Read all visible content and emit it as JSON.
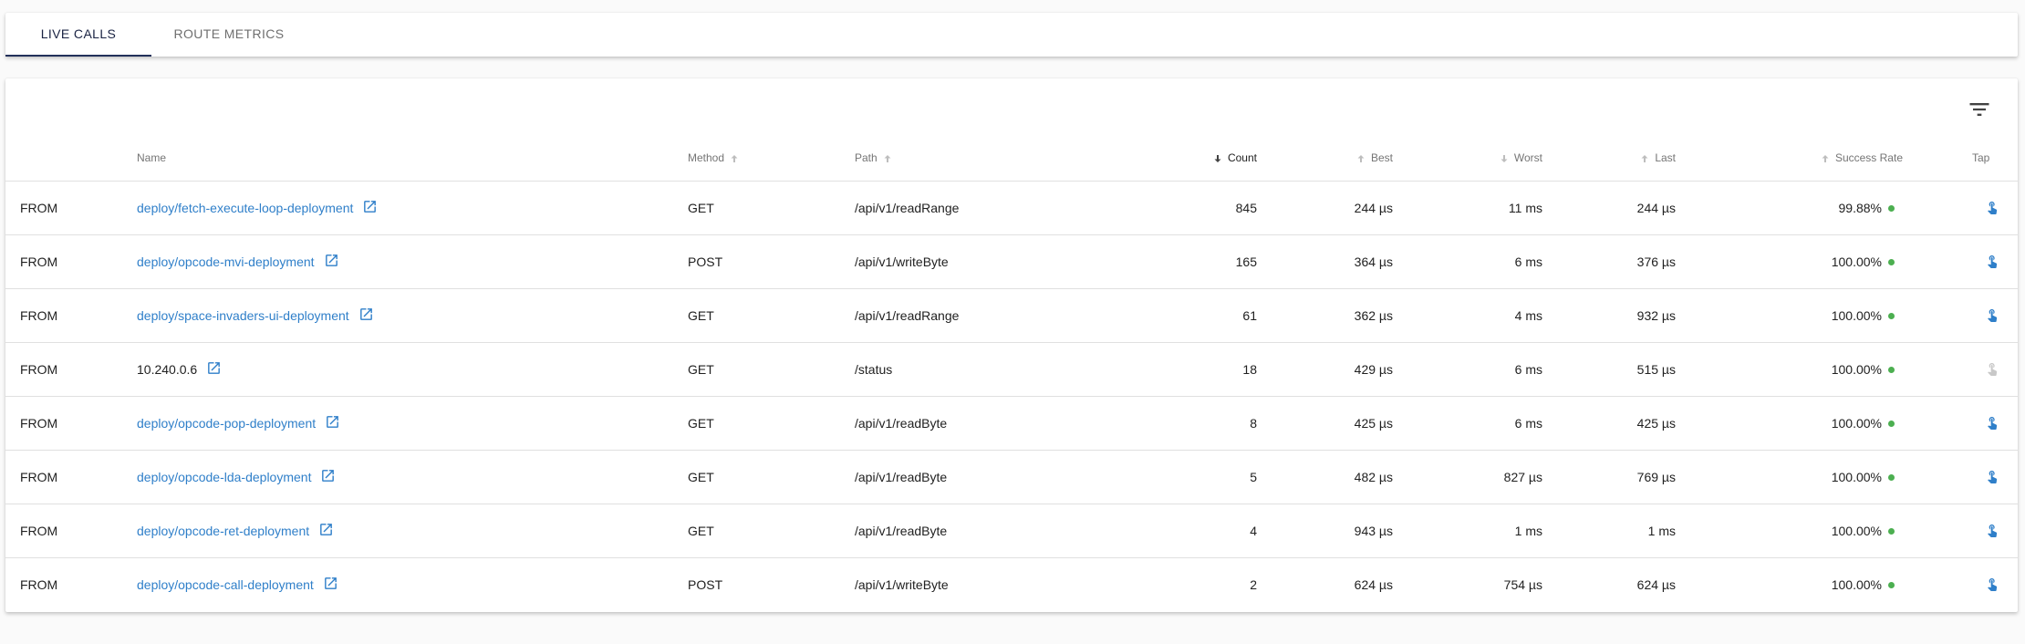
{
  "tabs": [
    {
      "label": "LIVE CALLS",
      "active": true
    },
    {
      "label": "ROUTE METRICS",
      "active": false
    }
  ],
  "toolbar": {
    "filter_icon": "filter-icon"
  },
  "table": {
    "headers": {
      "name": "Name",
      "method": "Method",
      "path": "Path",
      "count": "Count",
      "best": "Best",
      "worst": "Worst",
      "last": "Last",
      "success_rate": "Success Rate",
      "tap": "Tap"
    },
    "rows": [
      {
        "direction": "FROM",
        "name": "deploy/fetch-execute-loop-deployment",
        "is_link": true,
        "method": "GET",
        "path": "/api/v1/readRange",
        "count": "845",
        "best": "244 µs",
        "worst": "11 ms",
        "last": "244 µs",
        "success_rate": "99.88%",
        "tap_enabled": true
      },
      {
        "direction": "FROM",
        "name": "deploy/opcode-mvi-deployment",
        "is_link": true,
        "method": "POST",
        "path": "/api/v1/writeByte",
        "count": "165",
        "best": "364 µs",
        "worst": "6 ms",
        "last": "376 µs",
        "success_rate": "100.00%",
        "tap_enabled": true
      },
      {
        "direction": "FROM",
        "name": "deploy/space-invaders-ui-deployment",
        "is_link": true,
        "method": "GET",
        "path": "/api/v1/readRange",
        "count": "61",
        "best": "362 µs",
        "worst": "4 ms",
        "last": "932 µs",
        "success_rate": "100.00%",
        "tap_enabled": true
      },
      {
        "direction": "FROM",
        "name": "10.240.0.6",
        "is_link": false,
        "method": "GET",
        "path": "/status",
        "count": "18",
        "best": "429 µs",
        "worst": "6 ms",
        "last": "515 µs",
        "success_rate": "100.00%",
        "tap_enabled": false
      },
      {
        "direction": "FROM",
        "name": "deploy/opcode-pop-deployment",
        "is_link": true,
        "method": "GET",
        "path": "/api/v1/readByte",
        "count": "8",
        "best": "425 µs",
        "worst": "6 ms",
        "last": "425 µs",
        "success_rate": "100.00%",
        "tap_enabled": true
      },
      {
        "direction": "FROM",
        "name": "deploy/opcode-lda-deployment",
        "is_link": true,
        "method": "GET",
        "path": "/api/v1/readByte",
        "count": "5",
        "best": "482 µs",
        "worst": "827 µs",
        "last": "769 µs",
        "success_rate": "100.00%",
        "tap_enabled": true
      },
      {
        "direction": "FROM",
        "name": "deploy/opcode-ret-deployment",
        "is_link": true,
        "method": "GET",
        "path": "/api/v1/readByte",
        "count": "4",
        "best": "943 µs",
        "worst": "1 ms",
        "last": "1 ms",
        "success_rate": "100.00%",
        "tap_enabled": true
      },
      {
        "direction": "FROM",
        "name": "deploy/opcode-call-deployment",
        "is_link": true,
        "method": "POST",
        "path": "/api/v1/writeByte",
        "count": "2",
        "best": "624 µs",
        "worst": "754 µs",
        "last": "624 µs",
        "success_rate": "100.00%",
        "tap_enabled": true
      }
    ]
  },
  "colors": {
    "link": "#2f7fc9",
    "success_dot": "#4caf50",
    "tab_indicator": "#22305a",
    "tap_enabled": "#2f7fc9",
    "tap_disabled": "#c8c8c8"
  }
}
